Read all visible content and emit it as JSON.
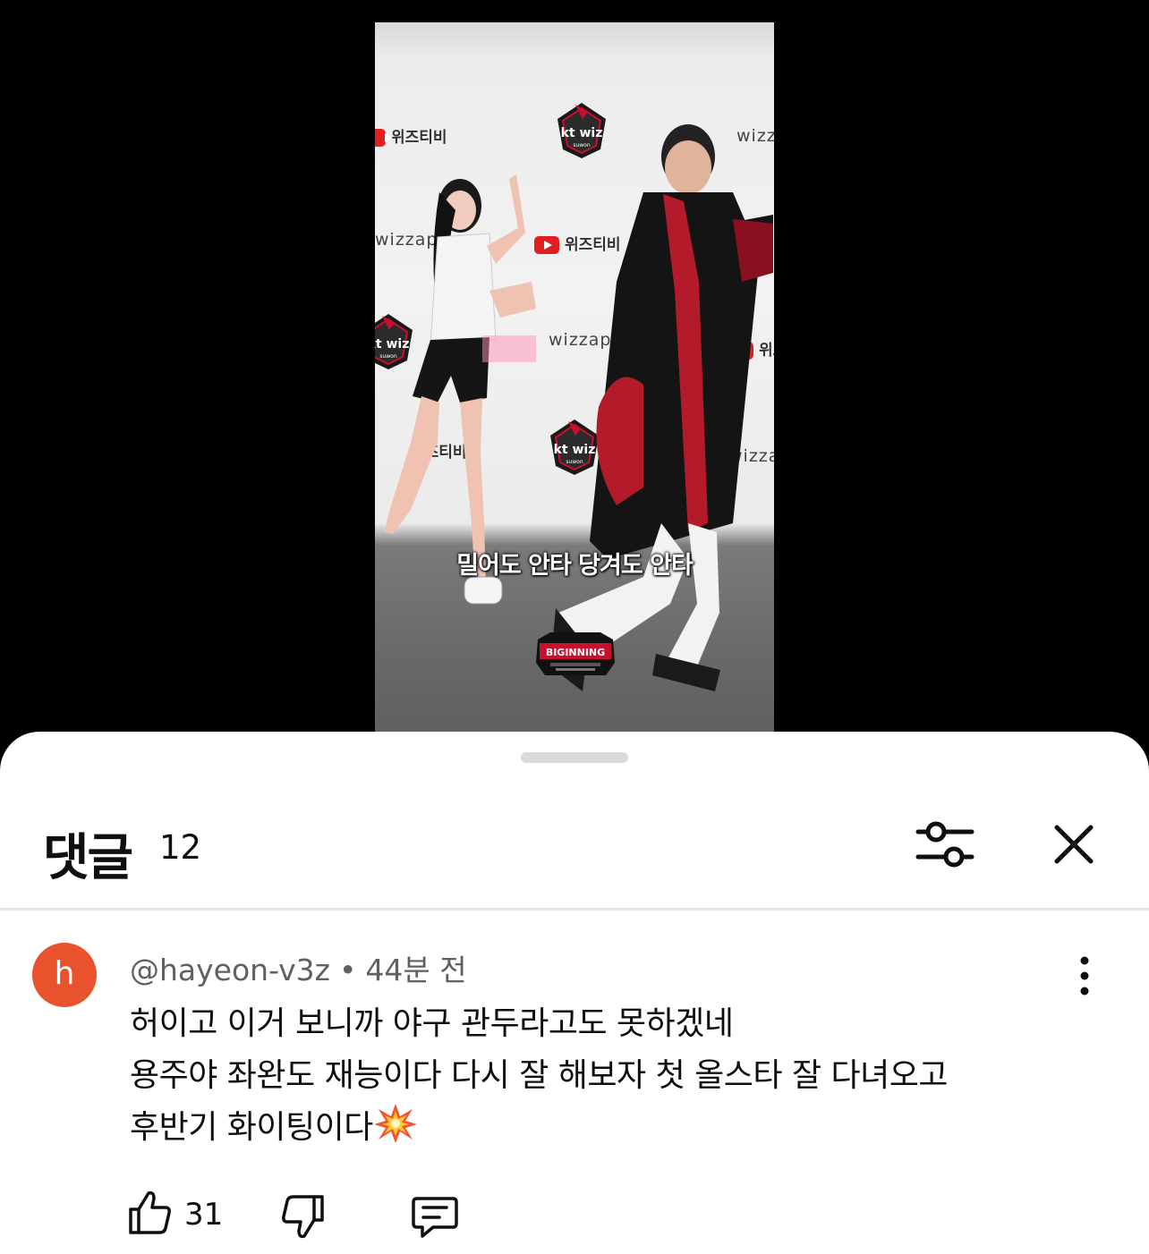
{
  "video": {
    "backdrop": {
      "channel_name": "위즈티비",
      "wizzap": "wizzap",
      "ktwiz": "kt wiz",
      "suwon": "suwon"
    },
    "subtitle": "밀어도 안타 당겨도 안타",
    "overlay_logo": "BIGINNING"
  },
  "comments_panel": {
    "title": "댓글",
    "count": "12",
    "filter_icon": "sliders-icon",
    "close_icon": "close-icon"
  },
  "comment": {
    "avatar_letter": "h",
    "avatar_color": "#e8522c",
    "author": "@hayeon-v3z",
    "separator": "•",
    "time": "44분 전",
    "lines": [
      "허이고 이거 보니까 야구 관두라고도 못하겠네",
      "용주야 좌완도 재능이다 다시 잘 해보자 첫 올스타 잘 다녀오고",
      "후반기 화이팅이다"
    ],
    "emoji_icon": "collision-icon",
    "likes": "31"
  }
}
